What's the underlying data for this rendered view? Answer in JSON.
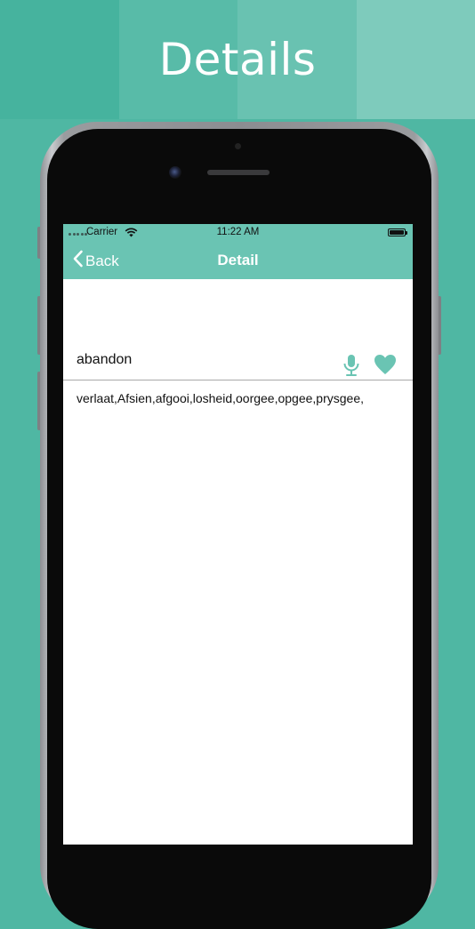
{
  "banner": {
    "title": "Details"
  },
  "status_bar": {
    "carrier": "Carrier",
    "time": "11:22 AM"
  },
  "nav_bar": {
    "back_label": "Back",
    "title": "Detail"
  },
  "entry": {
    "word": "abandon",
    "meaning": "verlaat,Afsien,afgooi,losheid,oorgee,opgee,prysgee,"
  },
  "icons": {
    "back": "chevron-left-icon",
    "pronounce": "microphone-icon",
    "favorite": "heart-icon",
    "wifi": "wifi-icon",
    "battery": "battery-icon"
  },
  "colors": {
    "accent": "#6ac4b3",
    "background": "#4fb7a3",
    "icon": "#6ac4b3"
  }
}
